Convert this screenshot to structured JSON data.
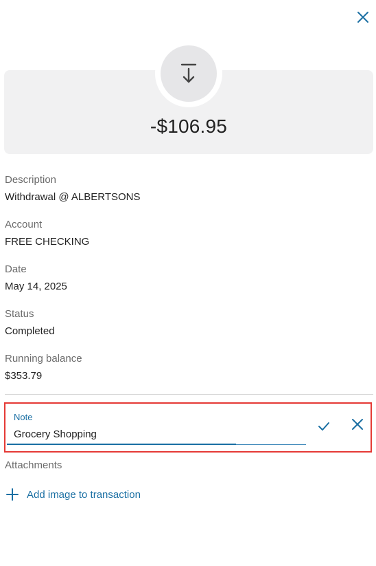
{
  "transaction": {
    "amount": "-$106.95",
    "icon": "withdrawal-arrow-icon"
  },
  "fields": {
    "description": {
      "label": "Description",
      "value": "Withdrawal @ ALBERTSONS"
    },
    "account": {
      "label": "Account",
      "value": "FREE CHECKING"
    },
    "date": {
      "label": "Date",
      "value": "May 14, 2025"
    },
    "status": {
      "label": "Status",
      "value": "Completed"
    },
    "running_balance": {
      "label": "Running balance",
      "value": "$353.79"
    }
  },
  "note": {
    "label": "Note",
    "value": "Grocery Shopping"
  },
  "attachments": {
    "label": "Attachments",
    "add_label": "Add image to transaction"
  },
  "colors": {
    "accent": "#1a6fa3",
    "highlight": "#e53935",
    "card_bg": "#f1f1f2"
  }
}
